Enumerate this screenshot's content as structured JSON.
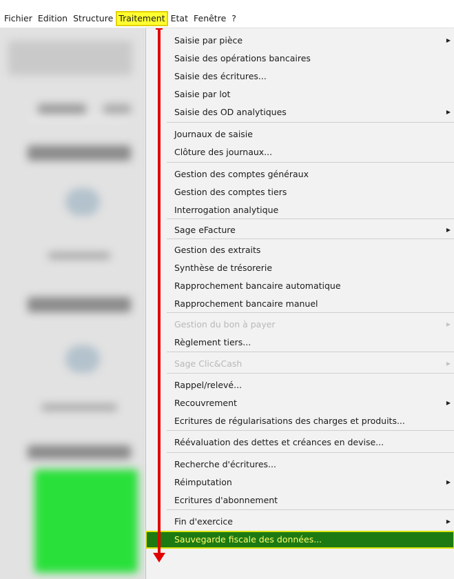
{
  "menubar": {
    "items": [
      "Fichier",
      "Edition",
      "Structure",
      "Traitement",
      "Etat",
      "Fenêtre",
      "?"
    ]
  },
  "menu": {
    "items": [
      {
        "label": "Saisie par pièce",
        "submenu": true,
        "disabled": false
      },
      {
        "label": "Saisie des opérations bancaires",
        "submenu": false,
        "disabled": false
      },
      {
        "label": "Saisie des écritures...",
        "submenu": false,
        "disabled": false
      },
      {
        "label": "Saisie par lot",
        "submenu": false,
        "disabled": false
      },
      {
        "label": "Saisie des OD analytiques",
        "submenu": true,
        "disabled": false
      },
      {
        "label": "Journaux de saisie",
        "submenu": false,
        "disabled": false
      },
      {
        "label": "Clôture des journaux...",
        "submenu": false,
        "disabled": false
      },
      {
        "label": "Gestion des comptes généraux",
        "submenu": false,
        "disabled": false
      },
      {
        "label": "Gestion des comptes tiers",
        "submenu": false,
        "disabled": false
      },
      {
        "label": "Interrogation analytique",
        "submenu": false,
        "disabled": false
      },
      {
        "label": "Sage eFacture",
        "submenu": true,
        "disabled": false
      },
      {
        "label": "Gestion des extraits",
        "submenu": false,
        "disabled": false
      },
      {
        "label": "Synthèse de trésorerie",
        "submenu": false,
        "disabled": false
      },
      {
        "label": "Rapprochement bancaire automatique",
        "submenu": false,
        "disabled": false
      },
      {
        "label": "Rapprochement bancaire manuel",
        "submenu": false,
        "disabled": false
      },
      {
        "label": "Gestion du bon à payer",
        "submenu": true,
        "disabled": true
      },
      {
        "label": "Règlement tiers...",
        "submenu": false,
        "disabled": false
      },
      {
        "label": "Sage Clic&Cash",
        "submenu": true,
        "disabled": true
      },
      {
        "label": "Rappel/relevé...",
        "submenu": false,
        "disabled": false
      },
      {
        "label": "Recouvrement",
        "submenu": true,
        "disabled": false
      },
      {
        "label": "Ecritures de régularisations des charges et produits...",
        "submenu": false,
        "disabled": false
      },
      {
        "label": "Réévaluation des dettes et créances en devise...",
        "submenu": false,
        "disabled": false
      },
      {
        "label": "Recherche d'écritures...",
        "submenu": false,
        "disabled": false
      },
      {
        "label": "Réimputation",
        "submenu": true,
        "disabled": false
      },
      {
        "label": "Ecritures d'abonnement",
        "submenu": false,
        "disabled": false
      },
      {
        "label": "Fin d'exercice",
        "submenu": true,
        "disabled": false
      },
      {
        "label": "Sauvegarde fiscale des données...",
        "submenu": false,
        "disabled": false,
        "selected": true
      }
    ]
  },
  "colors": {
    "menubar_highlight": "#ffff30",
    "selected_bg": "#1d7a12",
    "selected_text": "#ffff6a",
    "annotation_arrow": "#e10000"
  },
  "icons": {
    "submenu": "chevron-right-icon",
    "annotation": "red-arrow-down-icon"
  }
}
